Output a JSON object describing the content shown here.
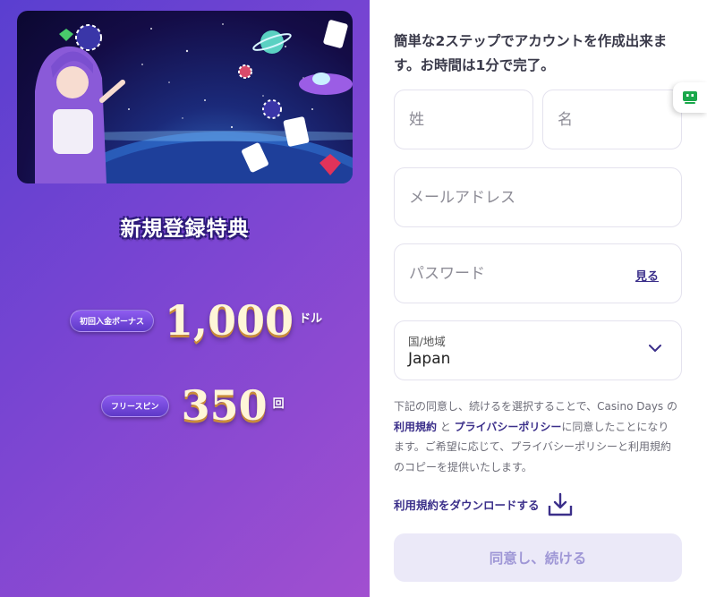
{
  "promo": {
    "title": "新規登録特典",
    "deposit_bonus": {
      "label": "初回入金ボーナス",
      "amount": "1,000",
      "unit": "ドル"
    },
    "free_spins": {
      "label": "フリースピン",
      "amount": "350",
      "unit": "回"
    }
  },
  "form": {
    "heading": "簡単な2ステップでアカウントを作成出来ます。お時間は1分で完了。",
    "last_name_placeholder": "姓",
    "first_name_placeholder": "名",
    "email_placeholder": "メールアドレス",
    "password_placeholder": "パスワード",
    "show_password_label": "見る",
    "country": {
      "label": "国/地域",
      "value": "Japan"
    },
    "legal": {
      "prefix": "下記の同意し、続けるを選択することで、Casino Days の",
      "terms_link": "利用規約",
      "and": " と ",
      "privacy_link": "プライバシーポリシー",
      "suffix": "に同意したことになります。ご希望に応じて、プライバシーポリシーと利用規約のコピーを提供いたします。"
    },
    "download_terms_label": "利用規約をダウンロードする",
    "submit_label": "同意し、続ける"
  },
  "icons": {
    "chevron": "chevron-down-icon",
    "download": "download-icon",
    "chat": "chat-bot-icon"
  },
  "colors": {
    "accent": "#3b2f8a",
    "submit_bg": "#ebe9f8",
    "submit_text": "#9f97d6",
    "chat_icon": "#1aa84b"
  }
}
